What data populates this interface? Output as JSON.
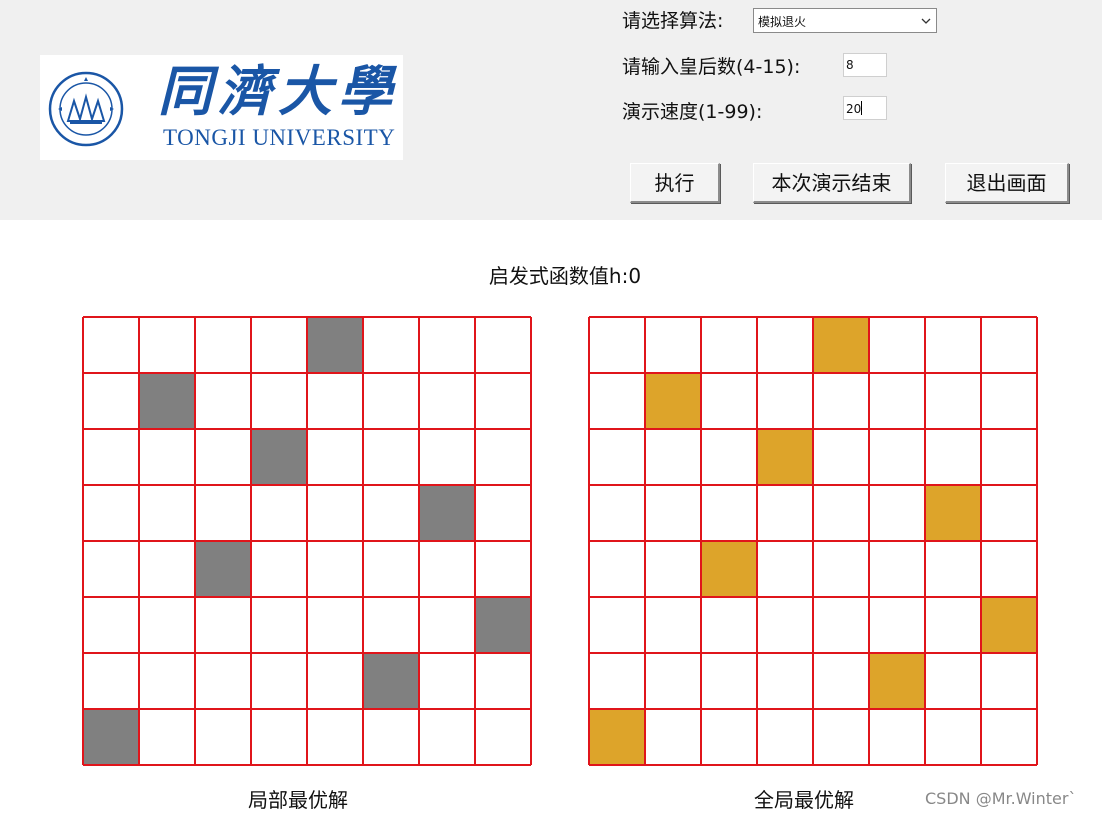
{
  "logo": {
    "cn": "同濟大學",
    "en": "TONGJI UNIVERSITY",
    "seal_text": "同濟大學 1907 TONGJI UNIVERSITY"
  },
  "controls": {
    "algo_label": "请选择算法:",
    "algo_selected": "模拟退火",
    "queens_label": "请输入皇后数(4-15):",
    "queens_value": "8",
    "speed_label": "演示速度(1-99):",
    "speed_value": "20"
  },
  "buttons": {
    "execute": "执行",
    "end_demo": "本次演示结束",
    "exit": "退出画面"
  },
  "heuristic": "启发式函数值h:0",
  "board_size": 8,
  "colors": {
    "grid": "#e0151b",
    "local_queen": "#808080",
    "global_queen": "#dda42a"
  },
  "local_board": {
    "caption": "局部最优解",
    "queens": [
      4,
      1,
      3,
      6,
      2,
      7,
      5,
      0
    ]
  },
  "global_board": {
    "caption": "全局最优解",
    "queens": [
      4,
      1,
      3,
      6,
      2,
      7,
      5,
      0
    ]
  },
  "watermark": "CSDN @Mr.Winter`"
}
